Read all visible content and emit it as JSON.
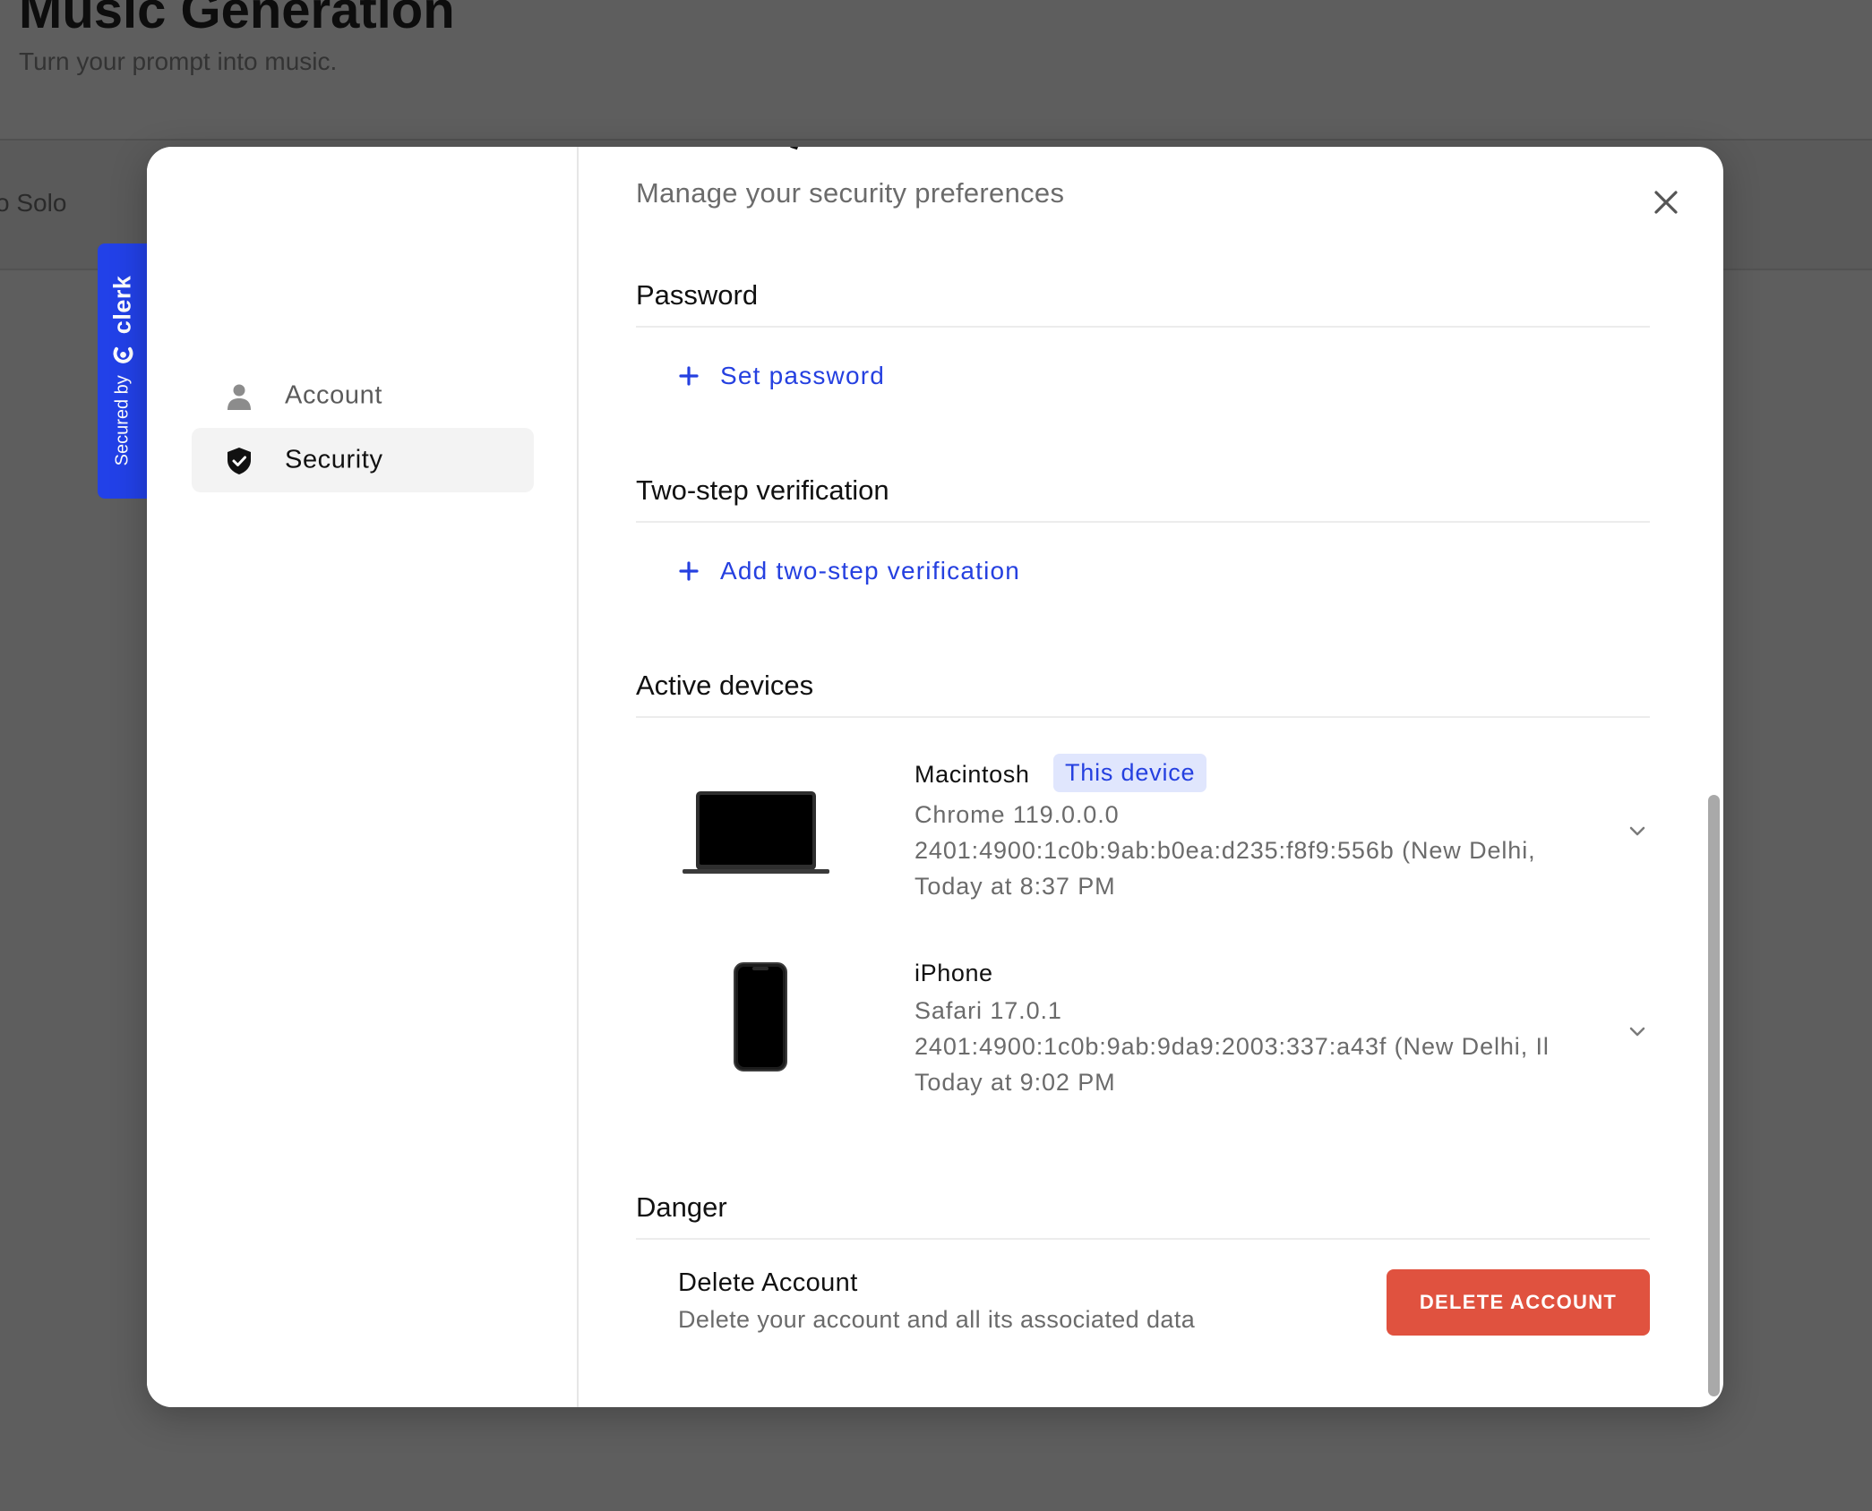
{
  "background": {
    "title": "Music Generation",
    "subtitle": "Turn your prompt into music.",
    "tab_fragment": "o Solo"
  },
  "clerk_badge": {
    "secured_by": "Secured by",
    "brand": "clerk",
    "color": "#2241e8"
  },
  "sidebar": {
    "items": [
      {
        "label": "Account",
        "icon": "user-icon",
        "active": false
      },
      {
        "label": "Security",
        "icon": "shield-check-icon",
        "active": true
      }
    ]
  },
  "header": {
    "subtitle": "Manage your security preferences",
    "close_icon": "close-icon"
  },
  "sections": {
    "password": {
      "title": "Password",
      "action_label": "Set password"
    },
    "two_step": {
      "title": "Two-step verification",
      "action_label": "Add two-step verification"
    },
    "devices": {
      "title": "Active devices",
      "items": [
        {
          "name": "Macintosh",
          "badge": "This device",
          "browser": "Chrome 119.0.0.0",
          "ip_location": "2401:4900:1c0b:9ab:b0ea:d235:f8f9:556b (New Delhi,",
          "last_active": "Today at 8:37 PM",
          "icon": "laptop-icon"
        },
        {
          "name": "iPhone",
          "browser": "Safari 17.0.1",
          "ip_location": "2401:4900:1c0b:9ab:9da9:2003:337:a43f (New Delhi, Il",
          "last_active": "Today at 9:02 PM",
          "icon": "phone-icon"
        }
      ]
    },
    "danger": {
      "title": "Danger",
      "item_title": "Delete Account",
      "item_description": "Delete your account and all its associated data",
      "button_label": "DELETE ACCOUNT",
      "button_color": "#e0523f"
    }
  },
  "colors": {
    "accent": "#2540e0",
    "badge_bg": "#e0e6fd",
    "overlay": "#5e5e5e"
  }
}
